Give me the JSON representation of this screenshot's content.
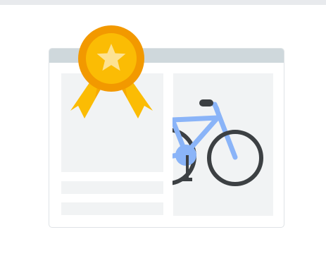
{
  "illustration": {
    "icons": [
      "award-ribbon-icon",
      "star-icon",
      "bicycle-icon"
    ],
    "colors": {
      "window_frame": "#dfe3e6",
      "titlebar": "#cfd8dc",
      "placeholder": "#f1f3f4",
      "badge_outer": "#f29900",
      "badge_inner": "#fbbc04",
      "star": "#fde293",
      "ribbon": "#fbbc04",
      "ribbon_shadow": "#f29900",
      "bike_frame": "#8ab4f8",
      "bike_tire": "#3c4043"
    }
  }
}
